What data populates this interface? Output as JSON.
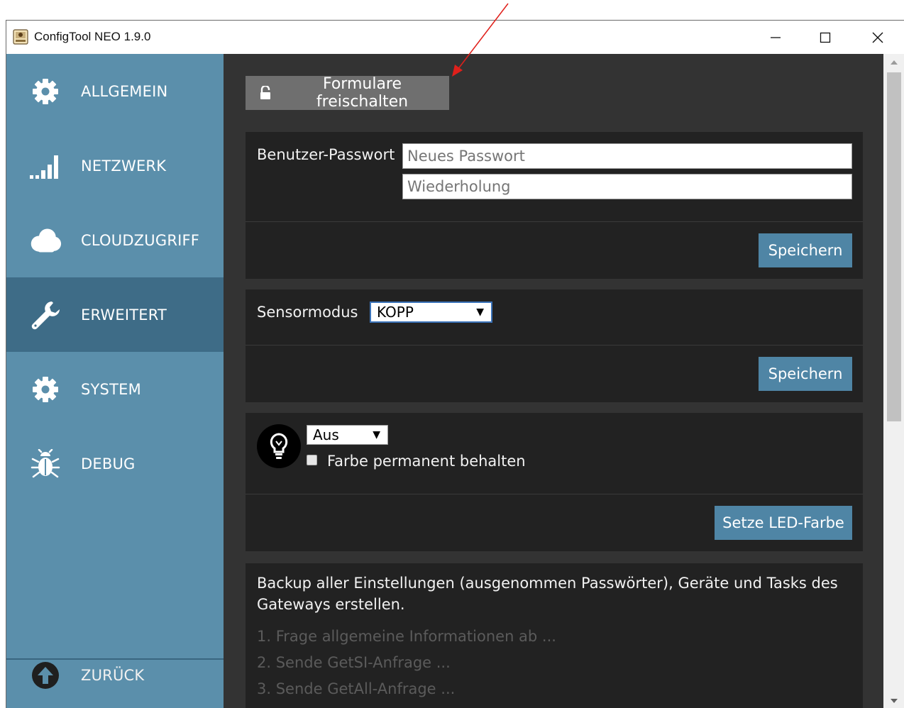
{
  "window": {
    "title": "ConfigTool NEO 1.9.0",
    "controls": [
      "minimize-icon",
      "maximize-icon",
      "close-icon"
    ]
  },
  "sidebar": {
    "items": [
      {
        "label": "ALLGEMEIN",
        "icon": "gear-icon",
        "active": false
      },
      {
        "label": "NETZWERK",
        "icon": "signal-bars-icon",
        "active": false
      },
      {
        "label": "CLOUDZUGRIFF",
        "icon": "cloud-icon",
        "active": false
      },
      {
        "label": "ERWEITERT",
        "icon": "wrench-icon",
        "active": true
      },
      {
        "label": "SYSTEM",
        "icon": "gear-icon",
        "active": false
      },
      {
        "label": "DEBUG",
        "icon": "bug-icon",
        "active": false
      }
    ],
    "back": {
      "label": "ZURÜCK",
      "icon": "arrow-up-circle-icon"
    }
  },
  "main": {
    "unlock_button": {
      "label": "Formulare freischalten",
      "icon": "unlock-icon"
    },
    "password_panel": {
      "label": "Benutzer-Passwort",
      "new_password_placeholder": "Neues Passwort",
      "repeat_placeholder": "Wiederholung",
      "save_label": "Speichern"
    },
    "sensor_panel": {
      "label": "Sensormodus",
      "selected": "KOPP",
      "save_label": "Speichern"
    },
    "led_panel": {
      "icon": "lightbulb-icon",
      "selected": "Aus",
      "checkbox_label": "Farbe permanent behalten",
      "checkbox_checked": false,
      "button_label": "Setze LED-Farbe"
    },
    "backup_panel": {
      "description_line1": "Backup aller Einstellungen (ausgenommen Passwörter), Geräte und Tasks des",
      "description_line2": "Gateways erstellen.",
      "steps": [
        "1. Frage allgemeine Informationen ab ...",
        "2. Sende GetSI-Anfrage ...",
        "3. Sende GetAll-Anfrage ..."
      ]
    }
  },
  "colors": {
    "sidebar": "#5b8fab",
    "sidebar_active": "#3e6c87",
    "main_bg": "#333333",
    "panel_bg": "#222222",
    "button_blue": "#4f85a5",
    "annotation": "#e0201b"
  }
}
